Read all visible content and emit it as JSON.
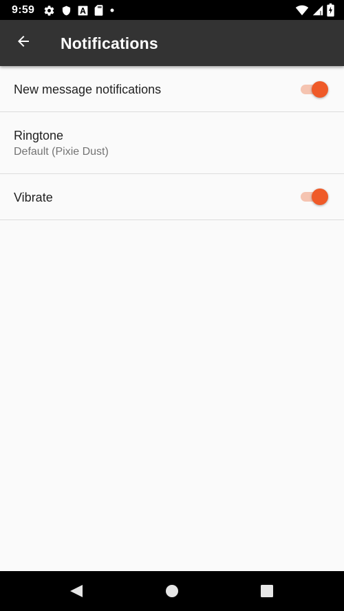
{
  "status_bar": {
    "time": "9:59",
    "left_icons": [
      "settings-gear-icon",
      "shield-icon",
      "font-a-icon",
      "sd-card-icon",
      "dot-icon"
    ],
    "right_icons": [
      "wifi-icon",
      "cellular-signal-icon",
      "battery-charging-icon"
    ]
  },
  "app_bar": {
    "back_icon": "arrow-back-icon",
    "title": "Notifications",
    "background_color": "#333333"
  },
  "settings": {
    "new_message": {
      "title": "New message notifications",
      "enabled": true
    },
    "ringtone": {
      "title": "Ringtone",
      "summary": "Default (Pixie Dust)"
    },
    "vibrate": {
      "title": "Vibrate",
      "enabled": true
    }
  },
  "accent_color": "#ef5a28",
  "nav_bar": {
    "buttons": [
      "nav-back-icon",
      "nav-home-icon",
      "nav-recents-icon"
    ]
  }
}
